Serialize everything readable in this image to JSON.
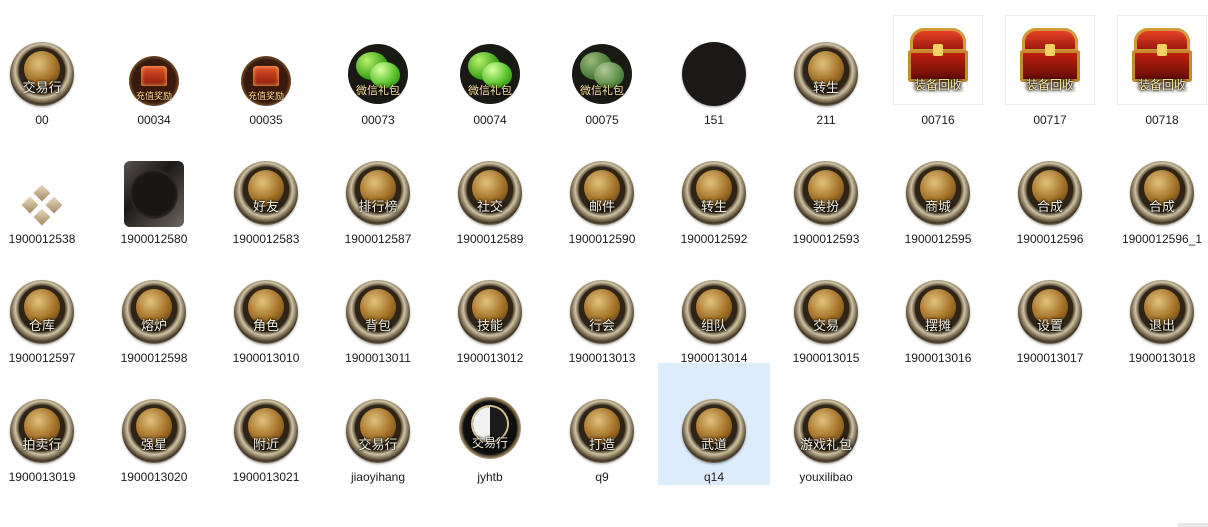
{
  "folder": {
    "files": [
      {
        "name": "00",
        "label": "交易行",
        "icon": "trade-house-icon"
      },
      {
        "name": "00034",
        "label": "充值奖励",
        "icon": "recharge-reward-chest-icon"
      },
      {
        "name": "00035",
        "label": "充值奖励",
        "icon": "recharge-reward-chest-icon"
      },
      {
        "name": "00073",
        "label": "微信礼包",
        "icon": "wechat-gift-icon"
      },
      {
        "name": "00074",
        "label": "微信礼包",
        "icon": "wechat-gift-icon"
      },
      {
        "name": "00075",
        "label": "微信礼包",
        "icon": "wechat-gift-icon"
      },
      {
        "name": "151",
        "label": "",
        "icon": "blank-round-frame-icon"
      },
      {
        "name": "211",
        "label": "转生",
        "icon": "rebirth-icon"
      },
      {
        "name": "00716",
        "label": "装备回收",
        "icon": "equipment-recycle-chest-icon"
      },
      {
        "name": "00717",
        "label": "装备回收",
        "icon": "equipment-recycle-chest-icon"
      },
      {
        "name": "00718",
        "label": "装备回收",
        "icon": "equipment-recycle-chest-icon"
      },
      {
        "name": "1900012538",
        "label": "",
        "icon": "diamond-ornament-icon"
      },
      {
        "name": "1900012580",
        "label": "",
        "icon": "blank-square-frame-icon"
      },
      {
        "name": "1900012583",
        "label": "好友",
        "icon": "friends-icon"
      },
      {
        "name": "1900012587",
        "label": "排行榜",
        "icon": "ranking-icon"
      },
      {
        "name": "1900012589",
        "label": "社交",
        "icon": "social-icon"
      },
      {
        "name": "1900012590",
        "label": "邮件",
        "icon": "mail-icon"
      },
      {
        "name": "1900012592",
        "label": "转生",
        "icon": "rebirth-icon"
      },
      {
        "name": "1900012593",
        "label": "装扮",
        "icon": "dress-up-icon"
      },
      {
        "name": "1900012595",
        "label": "商城",
        "icon": "shop-icon"
      },
      {
        "name": "1900012596",
        "label": "合成",
        "icon": "synthesis-icon"
      },
      {
        "name": "1900012596_1",
        "label": "合成",
        "icon": "synthesis-icon"
      },
      {
        "name": "1900012597",
        "label": "仓库",
        "icon": "warehouse-icon"
      },
      {
        "name": "1900012598",
        "label": "熔炉",
        "icon": "furnace-icon"
      },
      {
        "name": "1900013010",
        "label": "角色",
        "icon": "character-icon"
      },
      {
        "name": "1900013011",
        "label": "背包",
        "icon": "backpack-icon"
      },
      {
        "name": "1900013012",
        "label": "技能",
        "icon": "skill-icon"
      },
      {
        "name": "1900013013",
        "label": "行会",
        "icon": "guild-icon"
      },
      {
        "name": "1900013014",
        "label": "组队",
        "icon": "team-icon"
      },
      {
        "name": "1900013015",
        "label": "交易",
        "icon": "trade-icon"
      },
      {
        "name": "1900013016",
        "label": "摆摊",
        "icon": "stall-icon"
      },
      {
        "name": "1900013017",
        "label": "设置",
        "icon": "settings-icon"
      },
      {
        "name": "1900013018",
        "label": "退出",
        "icon": "exit-icon"
      },
      {
        "name": "1900013019",
        "label": "拍卖行",
        "icon": "auction-icon"
      },
      {
        "name": "1900013020",
        "label": "强星",
        "icon": "star-enhance-icon"
      },
      {
        "name": "1900013021",
        "label": "附近",
        "icon": "nearby-icon"
      },
      {
        "name": "jiaoyihang",
        "label": "交易行",
        "icon": "trade-house-icon"
      },
      {
        "name": "jyhtb",
        "label": "交易行",
        "icon": "taiji-trade-icon"
      },
      {
        "name": "q9",
        "label": "打造",
        "icon": "forge-icon"
      },
      {
        "name": "q14",
        "label": "武道",
        "icon": "martial-way-icon"
      },
      {
        "name": "youxilibao",
        "label": "游戏礼包",
        "icon": "game-gift-dragon-icon"
      }
    ],
    "selected": "q14"
  }
}
